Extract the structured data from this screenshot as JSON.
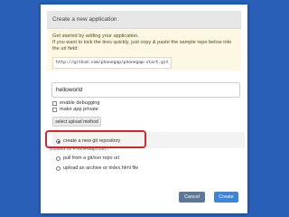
{
  "dialog": {
    "title": "Create a new application",
    "intro_line1": "Get started by adding your application.",
    "intro_line2": "If you want to kick the tires quickly, just copy & paste the sample repo below into the url field:",
    "sample_repo_url": "http://github.com/phonegap/phonegap-start.git"
  },
  "form": {
    "app_name_value": "helloworld",
    "enable_debugging_label": "enable debugging",
    "make_private_label": "make app private",
    "upload_method_tab": "select upload method",
    "options": [
      {
        "label": "create a new git repository",
        "selected": true
      },
      {
        "label": "pull from a git/svn repo url",
        "selected": false
      },
      {
        "label": "upload an archive or index.html file",
        "selected": false
      }
    ],
    "hosted_label": "(hosted on PhoneGap.com..."
  },
  "buttons": {
    "cancel_label": "Cancel",
    "create_label": "Create"
  },
  "colors": {
    "background": "#2a5fb8",
    "highlight_border": "#d7252d",
    "create_button": "#3b86d8",
    "cancel_button": "#5b7896"
  }
}
